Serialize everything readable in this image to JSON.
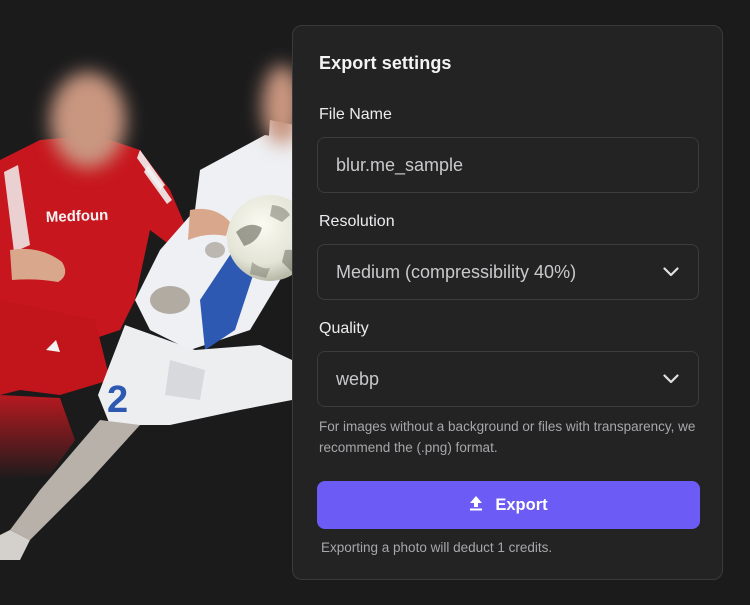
{
  "panel": {
    "title": "Export settings",
    "file_name": {
      "label": "File Name",
      "value": "blur.me_sample"
    },
    "resolution": {
      "label": "Resolution",
      "selected": "Medium (compressibility 40%)"
    },
    "quality": {
      "label": "Quality",
      "selected": "webp"
    },
    "hint": "For images without a background or files with transparency, we recommend the (.png) format.",
    "export_button": {
      "label": "Export",
      "icon": "upload-icon"
    },
    "note": "Exporting a photo will deduct 1 credits."
  },
  "photo": {
    "shirt_text": "Medfoun",
    "shorts_number": "2"
  },
  "colors": {
    "background": "#1b1b1c",
    "panel": "#232324",
    "accent": "#6c5cf5"
  }
}
